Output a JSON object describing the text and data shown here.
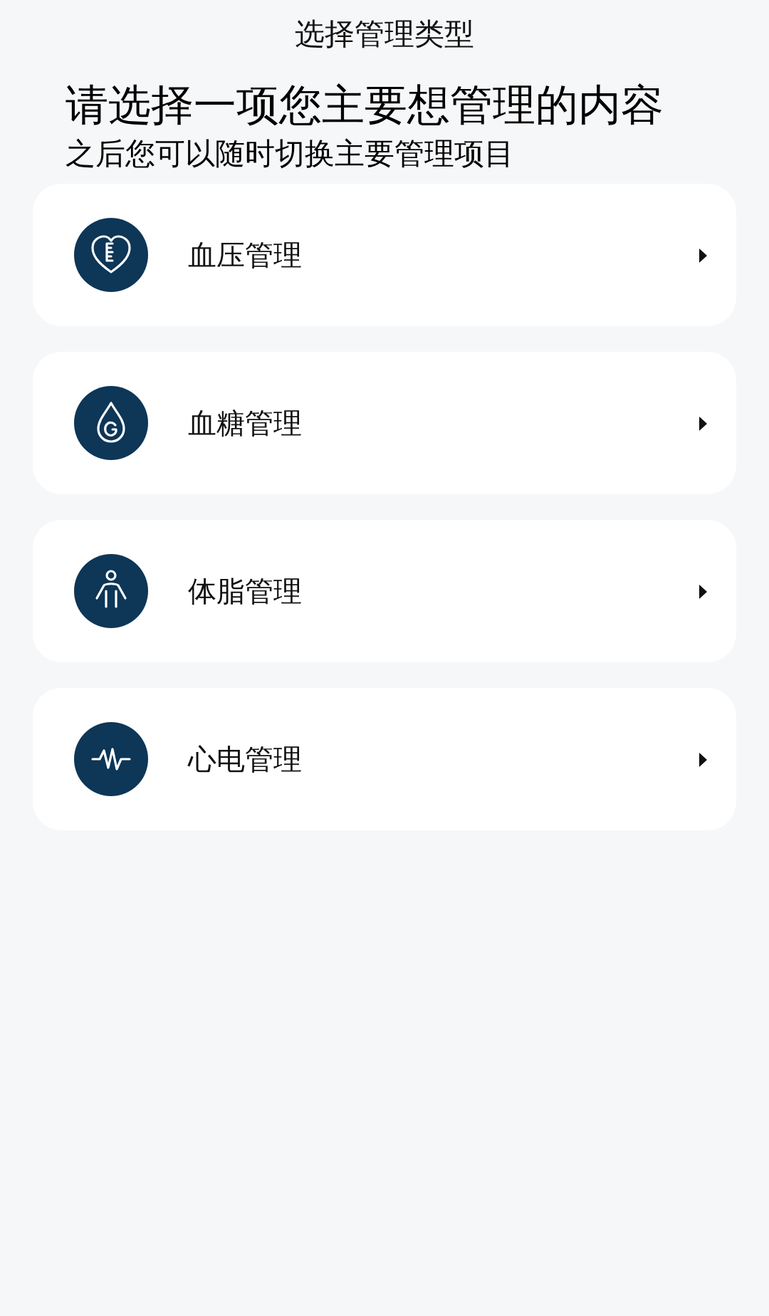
{
  "header": {
    "title": "选择管理类型"
  },
  "intro": {
    "heading": "请选择一项您主要想管理的内容",
    "subheading": "之后您可以随时切换主要管理项目"
  },
  "items": [
    {
      "kind": "heart",
      "label": "血压管理"
    },
    {
      "kind": "drop",
      "label": "血糖管理"
    },
    {
      "kind": "body",
      "label": "体脂管理"
    },
    {
      "kind": "pulse",
      "label": "心电管理"
    }
  ]
}
